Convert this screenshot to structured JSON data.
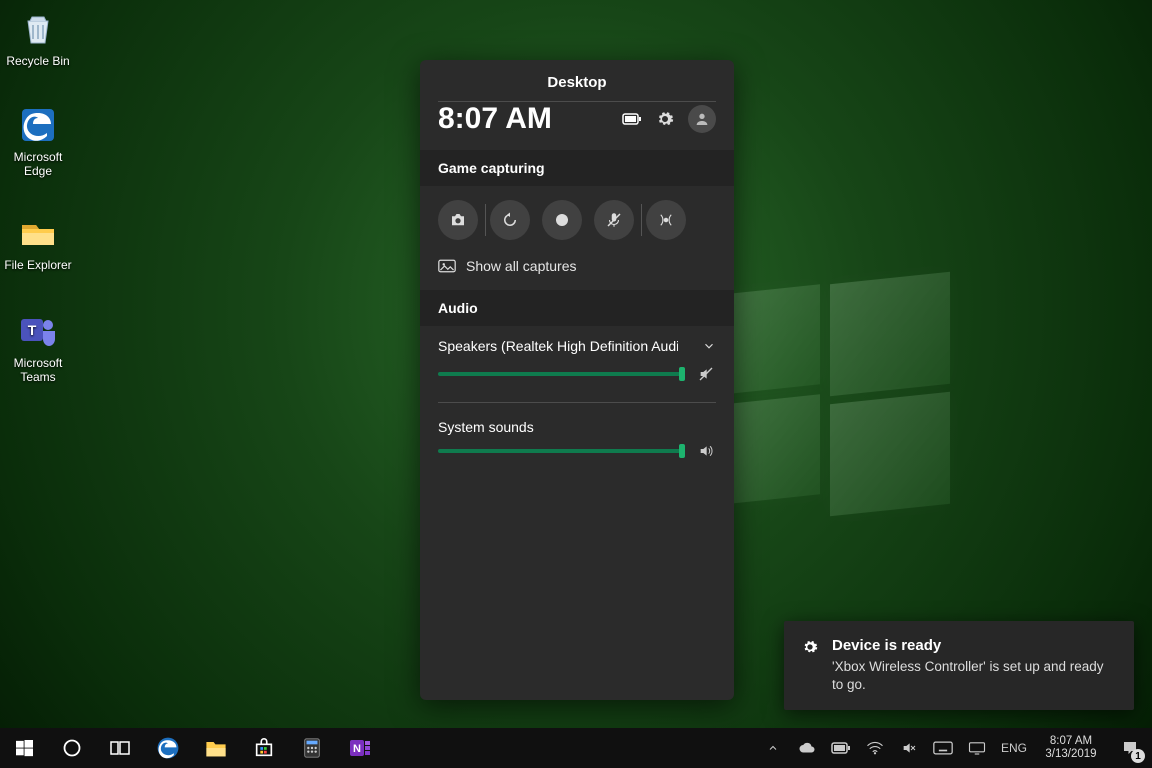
{
  "desktop_icons": [
    {
      "label": "Recycle Bin"
    },
    {
      "label": "Microsoft Edge"
    },
    {
      "label": "File Explorer"
    },
    {
      "label": "Microsoft Teams"
    }
  ],
  "gamebar": {
    "title": "Desktop",
    "time": "8:07 AM",
    "sections": {
      "capture": "Game capturing",
      "audio": "Audio"
    },
    "show_all_label": "Show all captures",
    "audio_device": "Speakers (Realtek High Definition Audio(SS",
    "system_sounds_label": "System sounds",
    "speaker_volume_pct": 100,
    "system_volume_pct": 100
  },
  "toast": {
    "title": "Device is ready",
    "body": "'Xbox Wireless Controller' is set up and ready to go."
  },
  "tray": {
    "lang": "ENG",
    "time": "8:07 AM",
    "date": "3/13/2019",
    "notifications": "1"
  }
}
